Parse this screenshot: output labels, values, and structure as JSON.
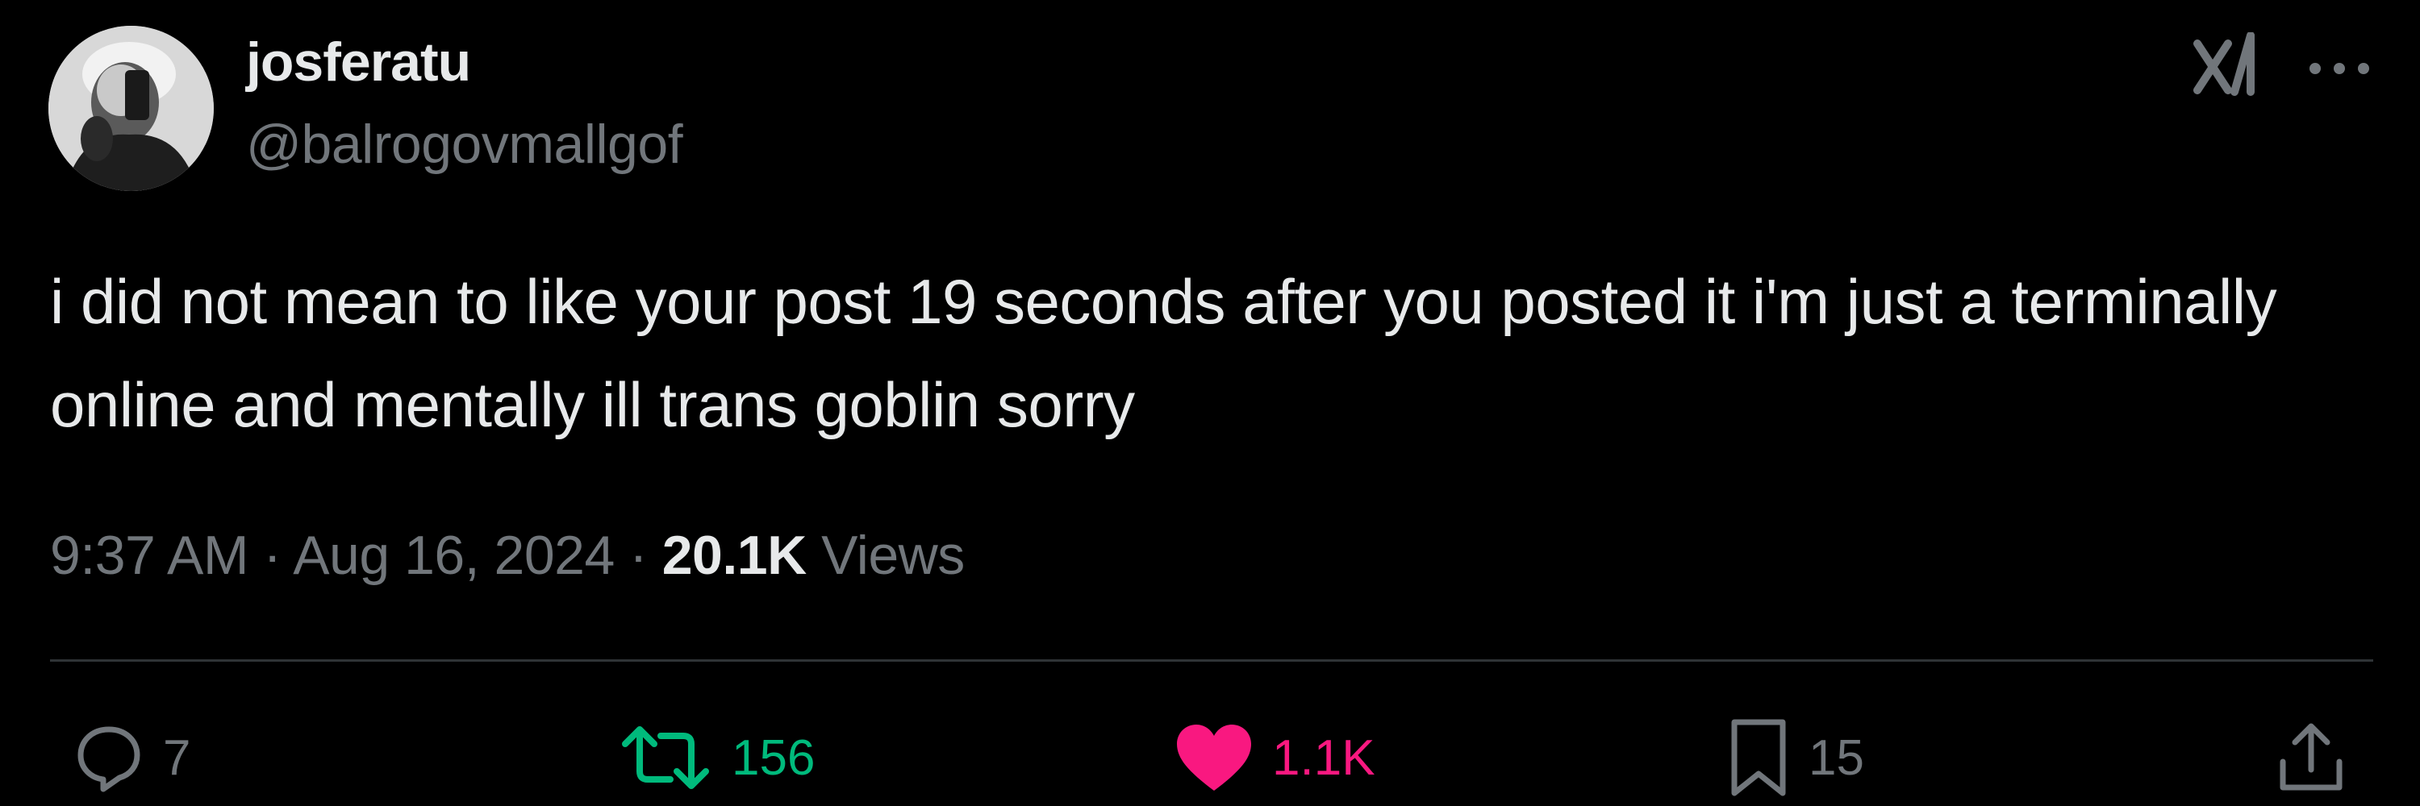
{
  "author": {
    "display_name": "josferatu",
    "handle": "@balrogovmallgof"
  },
  "post": {
    "text": "i did not mean to like your post 19 seconds after you posted it i'm just a terminally online and mentally ill trans goblin sorry",
    "time": "9:37 AM",
    "date": "Aug 16, 2024",
    "views_count": "20.1K",
    "views_label": "Views",
    "separator": " · "
  },
  "actions": {
    "replies": "7",
    "reposts": "156",
    "likes": "1.1K",
    "bookmarks": "15"
  },
  "icons": {
    "top_right": [
      "grok-icon",
      "more-icon"
    ],
    "actions": [
      "reply-icon",
      "repost-icon",
      "like-icon",
      "bookmark-icon",
      "share-icon"
    ]
  },
  "colors": {
    "background": "#000000",
    "primary_text": "#e7e9ea",
    "secondary_text": "#71767b",
    "repost_active": "#00ba7c",
    "like_active": "#f91880",
    "divider": "#2f3336"
  }
}
